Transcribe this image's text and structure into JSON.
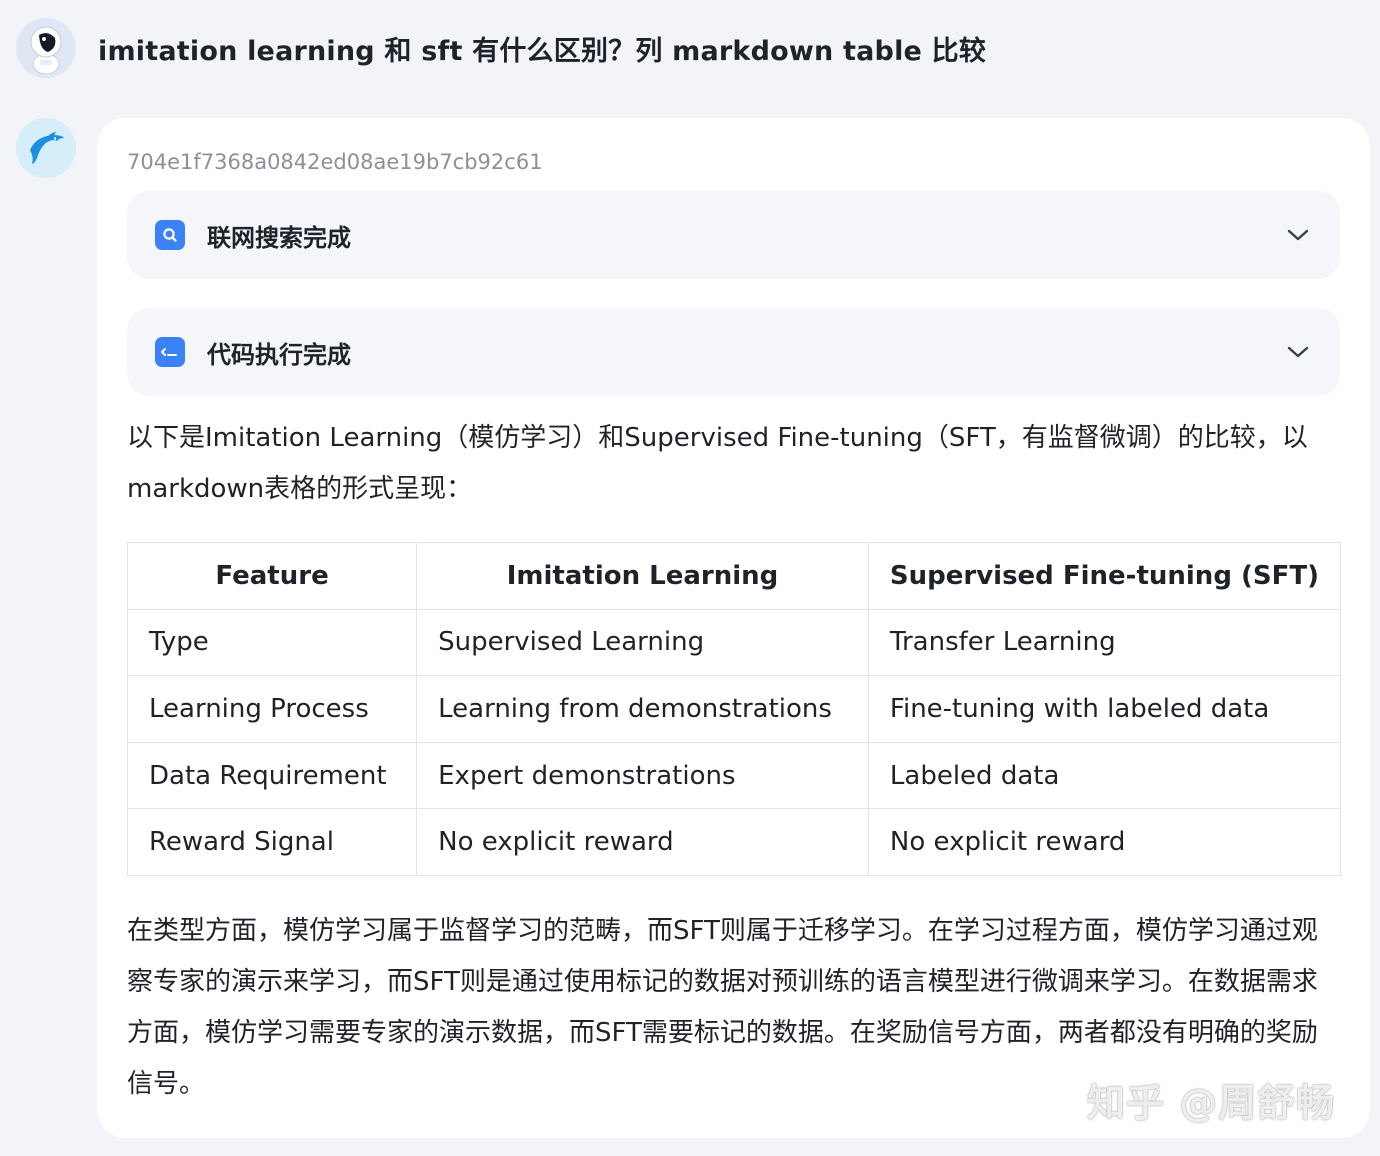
{
  "user": {
    "avatar_icon": "astronaut-avatar-icon",
    "question": "imitation learning 和 sft 有什么区别？列 markdown table 比较"
  },
  "assistant": {
    "avatar_icon": "dolphin-logo-icon",
    "message_id": "704e1f7368a0842ed08ae19b7cb92c61",
    "steps": [
      {
        "icon": "search-icon",
        "label": "联网搜索完成"
      },
      {
        "icon": "terminal-icon",
        "label": "代码执行完成"
      }
    ],
    "intro": "以下是Imitation Learning（模仿学习）和Supervised Fine-tuning（SFT，有监督微调）的比较，以markdown表格的形式呈现：",
    "table": {
      "headers": [
        "Feature",
        "Imitation Learning",
        "Supervised Fine-tuning (SFT)"
      ],
      "rows": [
        [
          "Type",
          "Supervised Learning",
          "Transfer Learning"
        ],
        [
          "Learning Process",
          "Learning from demonstrations",
          "Fine-tuning with labeled data"
        ],
        [
          "Data Requirement",
          "Expert demonstrations",
          "Labeled data"
        ],
        [
          "Reward Signal",
          "No explicit reward",
          "No explicit reward"
        ]
      ]
    },
    "summary": "在类型方面，模仿学习属于监督学习的范畴，而SFT则属于迁移学习。在学习过程方面，模仿学习通过观察专家的演示来学习，而SFT则是通过使用标记的数据对预训练的语言模型进行微调来学习。在数据需求方面，模仿学习需要专家的演示数据，而SFT需要标记的数据。在奖励信号方面，两者都没有明确的奖励信号。"
  },
  "watermark": "知乎 @周舒畅",
  "colors": {
    "accent": "#3b82f6",
    "card_bg": "#ffffff",
    "page_bg": "#f2f4f8",
    "step_bg": "#f4f6f9"
  }
}
